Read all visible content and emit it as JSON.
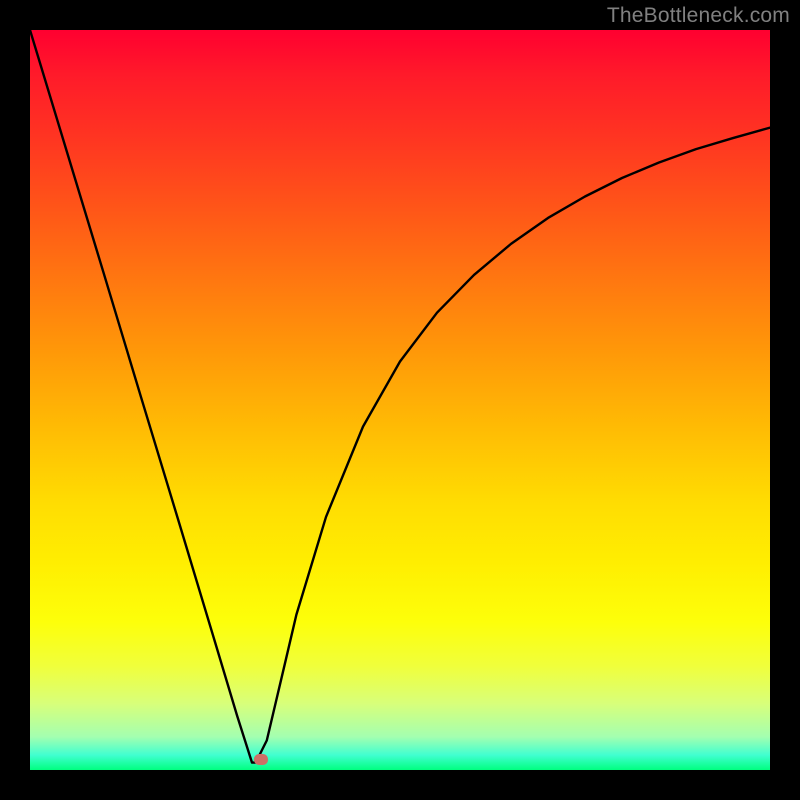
{
  "watermark": "TheBottleneck.com",
  "chart_data": {
    "type": "line",
    "title": "",
    "xlabel": "",
    "ylabel": "",
    "xlim": [
      0,
      1
    ],
    "ylim": [
      0,
      1
    ],
    "series": [
      {
        "name": "bottleneck-curve",
        "x": [
          0.0,
          0.05,
          0.1,
          0.15,
          0.2,
          0.25,
          0.28,
          0.3,
          0.305,
          0.32,
          0.345,
          0.36,
          0.4,
          0.45,
          0.5,
          0.55,
          0.6,
          0.65,
          0.7,
          0.75,
          0.8,
          0.85,
          0.9,
          0.95,
          1.0
        ],
        "y": [
          1.0,
          0.835,
          0.67,
          0.504,
          0.339,
          0.173,
          0.073,
          0.01,
          0.01,
          0.04,
          0.146,
          0.21,
          0.342,
          0.464,
          0.552,
          0.618,
          0.669,
          0.711,
          0.746,
          0.775,
          0.8,
          0.821,
          0.839,
          0.854,
          0.868
        ]
      }
    ],
    "marker": {
      "x": 0.312,
      "y": 0.015,
      "color": "#cc6f66"
    },
    "background_gradient": {
      "top_color": "#ff0030",
      "bottom_color": "#00ff80"
    }
  }
}
